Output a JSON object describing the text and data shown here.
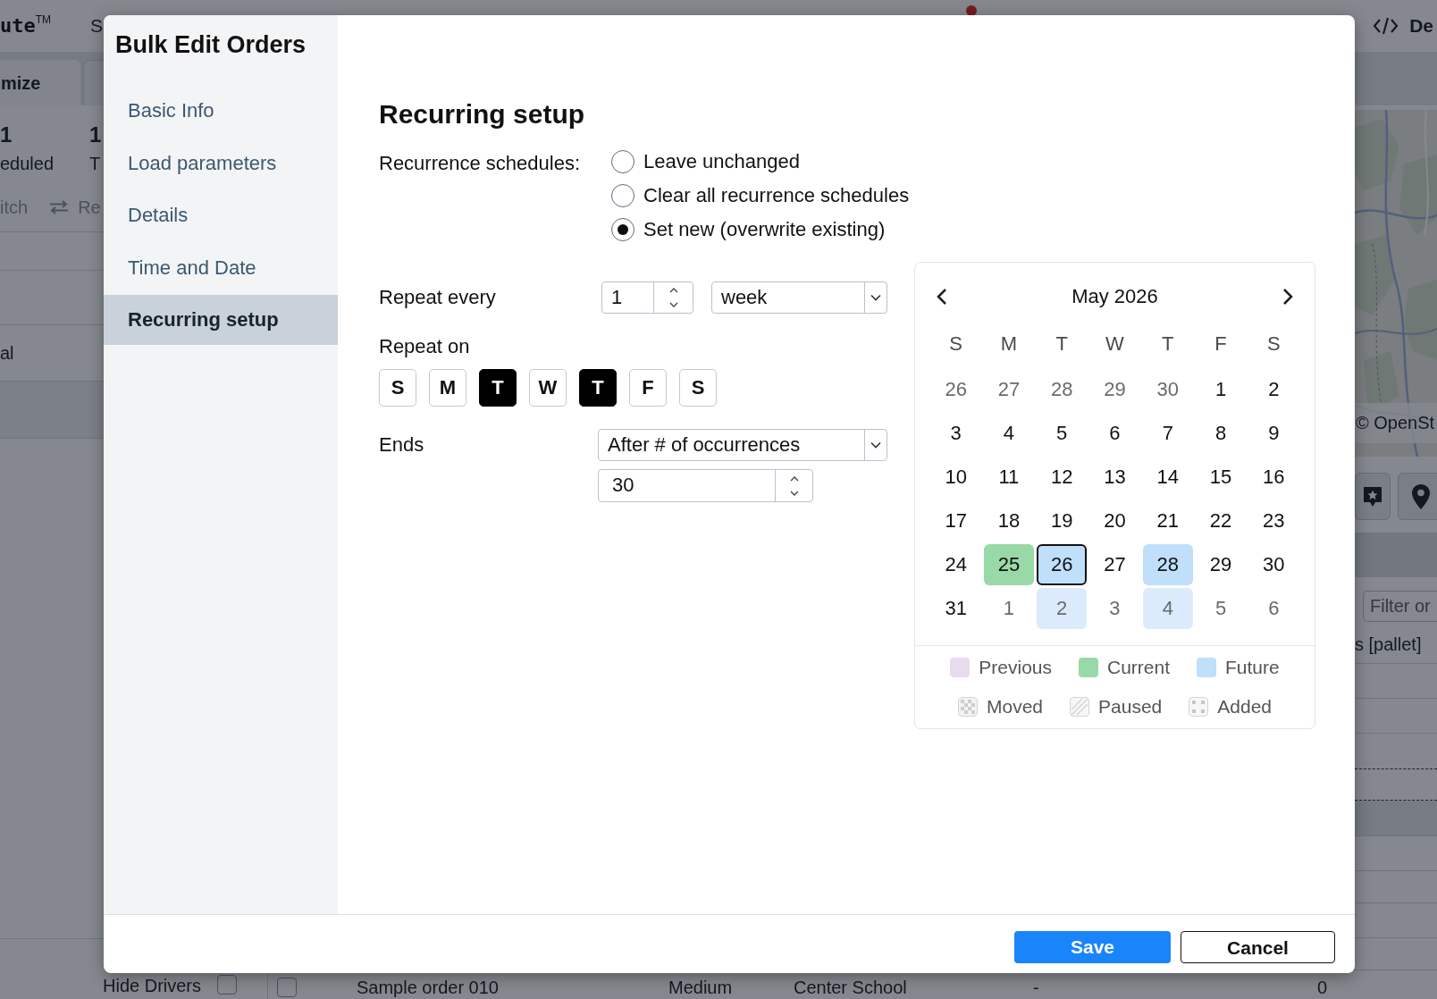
{
  "app": {
    "logo": "ute$^{TM}$",
    "nav_item": "S",
    "notification": true,
    "dev_link": "De",
    "tabs": [
      {
        "label": "mize",
        "selected": true
      },
      {
        "selected": false
      }
    ],
    "stats": [
      {
        "value": "1",
        "label": "eduled"
      },
      {
        "value": "1",
        "label": "T"
      }
    ],
    "toolbar": [
      {
        "kind": "text",
        "label": "itch"
      },
      {
        "kind": "icon-text",
        "label": "Re"
      }
    ],
    "list_item": "al",
    "hide_drivers": {
      "label": "Hide Drivers",
      "checked": false
    },
    "order_row": {
      "checked": false,
      "cells": [
        "Sample order 010",
        "Medium",
        "Center School",
        "-",
        "0"
      ]
    },
    "map_attribution": "© OpenSt",
    "filter": {
      "placeholder": "Filter or"
    },
    "column_header": "s [pallet]"
  },
  "modal": {
    "title": "Bulk Edit Orders",
    "nav": [
      {
        "label": "Basic Info",
        "selected": false
      },
      {
        "label": "Load parameters",
        "selected": false
      },
      {
        "label": "Details",
        "selected": false
      },
      {
        "label": "Time and Date",
        "selected": false
      },
      {
        "label": "Recurring setup",
        "selected": true
      }
    ],
    "heading": "Recurring setup",
    "recurrence": {
      "label": "Recurrence schedules:",
      "options": [
        {
          "label": "Leave unchanged",
          "selected": false
        },
        {
          "label": "Clear all recurrence schedules",
          "selected": false
        },
        {
          "label": "Set new (overwrite existing)",
          "selected": true
        }
      ]
    },
    "repeat_every": {
      "label": "Repeat every",
      "value": "1",
      "unit": "week"
    },
    "repeat_on": {
      "label": "Repeat on",
      "days": [
        {
          "label": "S",
          "selected": false
        },
        {
          "label": "M",
          "selected": false
        },
        {
          "label": "T",
          "selected": true
        },
        {
          "label": "W",
          "selected": false
        },
        {
          "label": "T",
          "selected": true
        },
        {
          "label": "F",
          "selected": false
        },
        {
          "label": "S",
          "selected": false
        }
      ]
    },
    "ends": {
      "label": "Ends",
      "mode": "After # of occurrences",
      "count": "30"
    },
    "calendar": {
      "month": "May 2026",
      "weekdays": [
        "S",
        "M",
        "T",
        "W",
        "T",
        "F",
        "S"
      ],
      "weeks": [
        [
          {
            "day": "26",
            "muted": true,
            "current": false,
            "future": false,
            "selected": false
          },
          {
            "day": "27",
            "muted": true,
            "current": false,
            "future": false,
            "selected": false
          },
          {
            "day": "28",
            "muted": true,
            "current": false,
            "future": false,
            "selected": false
          },
          {
            "day": "29",
            "muted": true,
            "current": false,
            "future": false,
            "selected": false
          },
          {
            "day": "30",
            "muted": true,
            "current": false,
            "future": false,
            "selected": false
          },
          {
            "day": "1",
            "muted": false,
            "current": false,
            "future": false,
            "selected": false
          },
          {
            "day": "2",
            "muted": false,
            "current": false,
            "future": false,
            "selected": false
          }
        ],
        [
          {
            "day": "3",
            "muted": false,
            "current": false,
            "future": false,
            "selected": false
          },
          {
            "day": "4",
            "muted": false,
            "current": false,
            "future": false,
            "selected": false
          },
          {
            "day": "5",
            "muted": false,
            "current": false,
            "future": false,
            "selected": false
          },
          {
            "day": "6",
            "muted": false,
            "current": false,
            "future": false,
            "selected": false
          },
          {
            "day": "7",
            "muted": false,
            "current": false,
            "future": false,
            "selected": false
          },
          {
            "day": "8",
            "muted": false,
            "current": false,
            "future": false,
            "selected": false
          },
          {
            "day": "9",
            "muted": false,
            "current": false,
            "future": false,
            "selected": false
          }
        ],
        [
          {
            "day": "10",
            "muted": false,
            "current": false,
            "future": false,
            "selected": false
          },
          {
            "day": "11",
            "muted": false,
            "current": false,
            "future": false,
            "selected": false
          },
          {
            "day": "12",
            "muted": false,
            "current": false,
            "future": false,
            "selected": false
          },
          {
            "day": "13",
            "muted": false,
            "current": false,
            "future": false,
            "selected": false
          },
          {
            "day": "14",
            "muted": false,
            "current": false,
            "future": false,
            "selected": false
          },
          {
            "day": "15",
            "muted": false,
            "current": false,
            "future": false,
            "selected": false
          },
          {
            "day": "16",
            "muted": false,
            "current": false,
            "future": false,
            "selected": false
          }
        ],
        [
          {
            "day": "17",
            "muted": false,
            "current": false,
            "future": false,
            "selected": false
          },
          {
            "day": "18",
            "muted": false,
            "current": false,
            "future": false,
            "selected": false
          },
          {
            "day": "19",
            "muted": false,
            "current": false,
            "future": false,
            "selected": false
          },
          {
            "day": "20",
            "muted": false,
            "current": false,
            "future": false,
            "selected": false
          },
          {
            "day": "21",
            "muted": false,
            "current": false,
            "future": false,
            "selected": false
          },
          {
            "day": "22",
            "muted": false,
            "current": false,
            "future": false,
            "selected": false
          },
          {
            "day": "23",
            "muted": false,
            "current": false,
            "future": false,
            "selected": false
          }
        ],
        [
          {
            "day": "24",
            "muted": false,
            "current": false,
            "future": false,
            "selected": false
          },
          {
            "day": "25",
            "muted": false,
            "current": true,
            "future": false,
            "selected": false
          },
          {
            "day": "26",
            "muted": false,
            "current": false,
            "future": true,
            "selected": true
          },
          {
            "day": "27",
            "muted": false,
            "current": false,
            "future": false,
            "selected": false
          },
          {
            "day": "28",
            "muted": false,
            "current": false,
            "future": true,
            "selected": false
          },
          {
            "day": "29",
            "muted": false,
            "current": false,
            "future": false,
            "selected": false
          },
          {
            "day": "30",
            "muted": false,
            "current": false,
            "future": false,
            "selected": false
          }
        ],
        [
          {
            "day": "31",
            "muted": false,
            "current": false,
            "future": false,
            "selected": false
          },
          {
            "day": "1",
            "muted": true,
            "current": false,
            "future": false,
            "selected": false
          },
          {
            "day": "2",
            "muted": true,
            "current": false,
            "future": true,
            "selected": false
          },
          {
            "day": "3",
            "muted": true,
            "current": false,
            "future": false,
            "selected": false
          },
          {
            "day": "4",
            "muted": true,
            "current": false,
            "future": true,
            "selected": false
          },
          {
            "day": "5",
            "muted": true,
            "current": false,
            "future": false,
            "selected": false
          },
          {
            "day": "6",
            "muted": true,
            "current": false,
            "future": false,
            "selected": false
          }
        ]
      ],
      "legend": [
        {
          "label": "Previous",
          "kind": "fill",
          "color": "#e9dbee"
        },
        {
          "label": "Current",
          "kind": "fill",
          "color": "#99d9a8"
        },
        {
          "label": "Future",
          "kind": "fill",
          "color": "#bfdffa"
        },
        {
          "label": "Moved",
          "kind": "checker"
        },
        {
          "label": "Paused",
          "kind": "hatch"
        },
        {
          "label": "Added",
          "kind": "dots"
        }
      ]
    },
    "buttons": [
      {
        "label": "Save",
        "kind": "primary"
      },
      {
        "label": "Cancel",
        "kind": "outline"
      }
    ]
  }
}
